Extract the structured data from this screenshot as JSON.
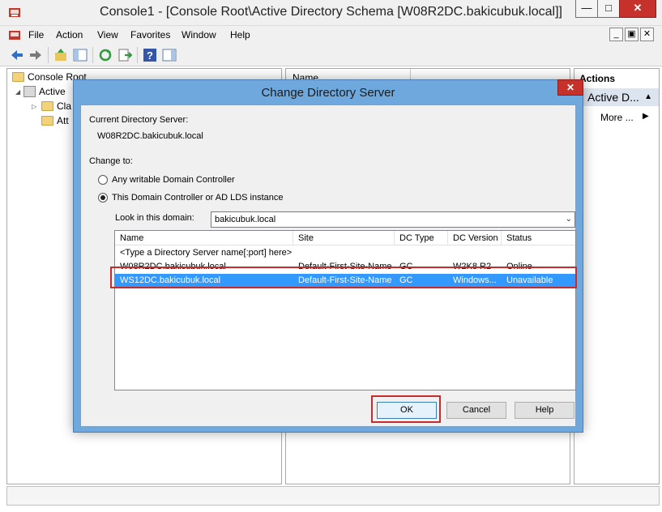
{
  "window": {
    "title": "Console1 - [Console Root\\Active Directory Schema [W08R2DC.bakicubuk.local]]",
    "min_glyph": "—",
    "max_glyph": "□",
    "close_glyph": "✕"
  },
  "menu": {
    "items": [
      "File",
      "Action",
      "View",
      "Favorites",
      "Window",
      "Help"
    ],
    "mdi_min": "_",
    "mdi_restore": "▣",
    "mdi_close": "✕"
  },
  "tree": {
    "items": [
      {
        "label": "Console Root"
      },
      {
        "label": "Active"
      },
      {
        "label": "Cla"
      },
      {
        "label": "Att"
      }
    ]
  },
  "list": {
    "header": "Name"
  },
  "actions": {
    "header": "Actions",
    "subheader": "Active D...",
    "more": "More ..."
  },
  "dialog": {
    "title": "Change Directory Server",
    "close_glyph": "✕",
    "current_label": "Current Directory Server:",
    "current_value": "W08R2DC.bakicubuk.local",
    "change_to_label": "Change to:",
    "radio_any": "Any writable Domain Controller",
    "radio_this": "This Domain Controller or AD LDS instance",
    "domain_label": "Look in this domain:",
    "domain_value": "bakicubuk.local",
    "columns": [
      "Name",
      "Site",
      "DC Type",
      "DC Version",
      "Status"
    ],
    "placeholder_row": "<Type a Directory Server name[:port] here>",
    "rows": [
      {
        "name": "W08R2DC.bakicubuk.local",
        "site": "Default-First-Site-Name",
        "type": "GC",
        "version": "W2K8 R2",
        "status": "Online"
      },
      {
        "name": "WS12DC.bakicubuk.local",
        "site": "Default-First-Site-Name",
        "type": "GC",
        "version": "Windows...",
        "status": "Unavailable"
      }
    ],
    "ok": "OK",
    "cancel": "Cancel",
    "help": "Help"
  },
  "colors": {
    "dialog_frame": "#6fa8dc",
    "selection": "#3399ff",
    "highlight_outline": "#c62c2c",
    "close_red": "#c7312b"
  }
}
